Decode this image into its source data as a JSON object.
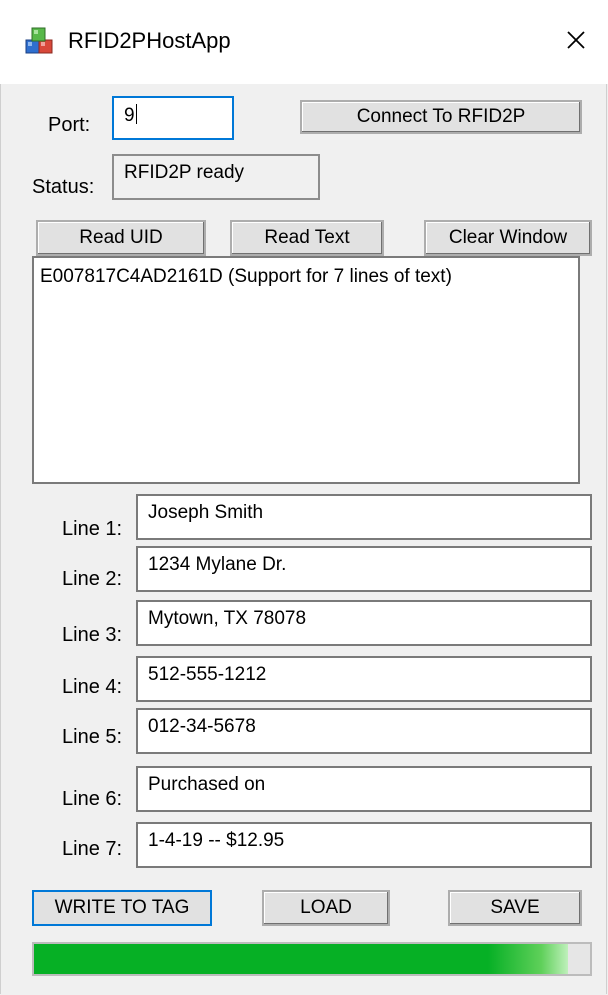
{
  "window": {
    "title": "RFID2PHostApp"
  },
  "port": {
    "label": "Port:",
    "value": "9"
  },
  "connect_button": "Connect To RFID2P",
  "status": {
    "label": "Status:",
    "value": "RFID2P ready"
  },
  "buttons": {
    "read_uid": "Read UID",
    "read_text": "Read Text",
    "clear_window": "Clear Window",
    "write_to_tag": "WRITE TO TAG",
    "load": "LOAD",
    "save": "SAVE"
  },
  "output_text": "E007817C4AD2161D (Support for 7 lines of text)",
  "lines": [
    {
      "label": "Line 1:",
      "value": "Joseph Smith"
    },
    {
      "label": "Line 2:",
      "value": "1234 Mylane Dr."
    },
    {
      "label": "Line 3:",
      "value": "Mytown, TX 78078"
    },
    {
      "label": "Line 4:",
      "value": "512-555-1212"
    },
    {
      "label": "Line 5:",
      "value": "012-34-5678"
    },
    {
      "label": "Line 6:",
      "value": "Purchased on"
    },
    {
      "label": "Line 7:",
      "value": "1-4-19 -- $12.95"
    }
  ],
  "progress": {
    "fraction": 0.96
  },
  "colors": {
    "progress_green": "#06b025",
    "focus_blue": "#0078d7"
  },
  "icons": {
    "app": "app-cubes-icon",
    "close": "close-icon"
  }
}
